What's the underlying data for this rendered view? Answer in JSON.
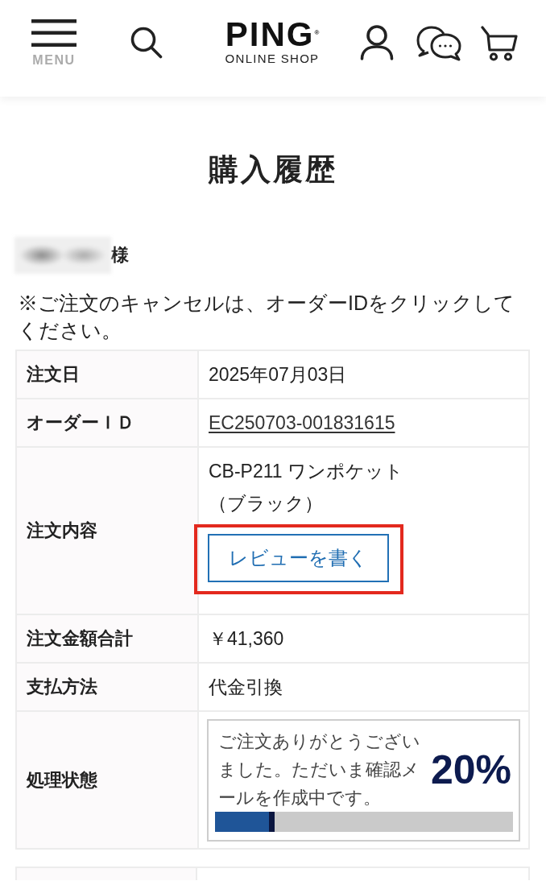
{
  "header": {
    "menu_button": {
      "label": "MENU"
    },
    "logo": {
      "wordmark": "PING$^{®}$",
      "tagline": "ONLINE SHOP"
    }
  },
  "page_title": "購入履歴",
  "customer": {
    "name_redacted": true,
    "honorific": "様"
  },
  "notice": "※ご注文のキャンセルは、オーダーIDをクリックしてください。",
  "order": {
    "rows": [
      {
        "kind": "text",
        "label": "注文日",
        "value": "2025年07月03日"
      },
      {
        "kind": "link",
        "label": "オーダーＩＤ",
        "value": "EC250703-001831615"
      },
      {
        "kind": "product",
        "label": "注文内容",
        "product_name": "CB-P211 ワンポケット",
        "variant": "（ブラック）",
        "review_button": {
          "label": "レビューを書く",
          "highlighted": true
        }
      },
      {
        "kind": "text",
        "label": "注文金額合計",
        "value": "￥41,360"
      },
      {
        "kind": "text",
        "label": "支払方法",
        "value": "代金引換"
      },
      {
        "kind": "status",
        "label": "処理状態",
        "message": "ご注文ありがとうございました。ただいま確認メールを作成中です。",
        "percent": "20%",
        "level": 0.2
      }
    ]
  }
}
